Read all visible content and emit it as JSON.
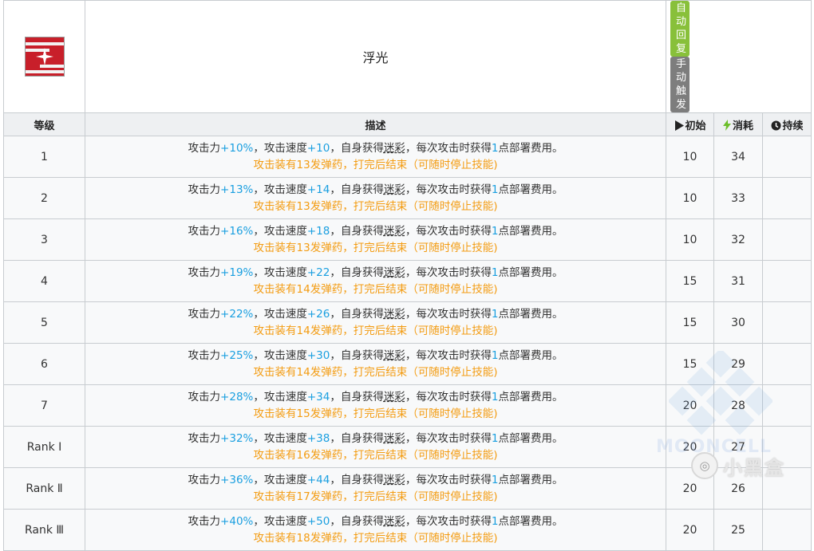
{
  "skill": {
    "name": "浮光",
    "tags": {
      "auto": "自动回复",
      "manual": "手动触发"
    }
  },
  "header": {
    "level": "等级",
    "desc": "描述",
    "initial": "初始",
    "cost": "消耗",
    "duration": "持续"
  },
  "rows": [
    {
      "level": "1",
      "atk": "+10%",
      "aspd": "+10",
      "line2": "攻击装有13发弹药，打完后结束（可随时停止技能)",
      "initial": "10",
      "cost": "34"
    },
    {
      "level": "2",
      "atk": "+13%",
      "aspd": "+14",
      "line2": "攻击装有13发弹药，打完后结束（可随时停止技能)",
      "initial": "10",
      "cost": "33"
    },
    {
      "level": "3",
      "atk": "+16%",
      "aspd": "+18",
      "line2": "攻击装有13发弹药，打完后结束（可随时停止技能)",
      "initial": "10",
      "cost": "32"
    },
    {
      "level": "4",
      "atk": "+19%",
      "aspd": "+22",
      "line2": "攻击装有14发弹药，打完后结束（可随时停止技能)",
      "initial": "15",
      "cost": "31"
    },
    {
      "level": "5",
      "atk": "+22%",
      "aspd": "+26",
      "line2": "攻击装有14发弹药，打完后结束（可随时停止技能)",
      "initial": "15",
      "cost": "30"
    },
    {
      "level": "6",
      "atk": "+25%",
      "aspd": "+30",
      "line2": "攻击装有14发弹药，打完后结束（可随时停止技能)",
      "initial": "15",
      "cost": "29"
    },
    {
      "level": "7",
      "atk": "+28%",
      "aspd": "+34",
      "line2": "攻击装有15发弹药，打完后结束（可随时停止技能)",
      "initial": "20",
      "cost": "28"
    },
    {
      "level": "Rank Ⅰ",
      "atk": "+32%",
      "aspd": "+38",
      "line2": "攻击装有16发弹药，打完后结束（可随时停止技能)",
      "initial": "20",
      "cost": "27"
    },
    {
      "level": "Rank Ⅱ",
      "atk": "+36%",
      "aspd": "+44",
      "line2": "攻击装有17发弹药，打完后结束（可随时停止技能)",
      "initial": "20",
      "cost": "26"
    },
    {
      "level": "Rank Ⅲ",
      "atk": "+40%",
      "aspd": "+50",
      "line2": "攻击装有18发弹药，打完后结束（可随时停止技能)",
      "initial": "20",
      "cost": "25"
    }
  ],
  "text": {
    "atk_label": "攻击力",
    "aspd_label": "，攻击速度",
    "self_gain": "，自身获得",
    "camo": "迷彩",
    "each_attack": "，每次攻击时获得",
    "one": "1",
    "dp_text": "点部署费用。"
  },
  "watermark": {
    "text": "MOONCELL",
    "logo_text": "小黑盒"
  },
  "colors": {
    "highlight": "#1a9fe0",
    "orange": "#f39c12",
    "auto_tag": "#88c03a",
    "manual_tag": "#7d7d7d",
    "icon_red": "#c81f2a"
  }
}
